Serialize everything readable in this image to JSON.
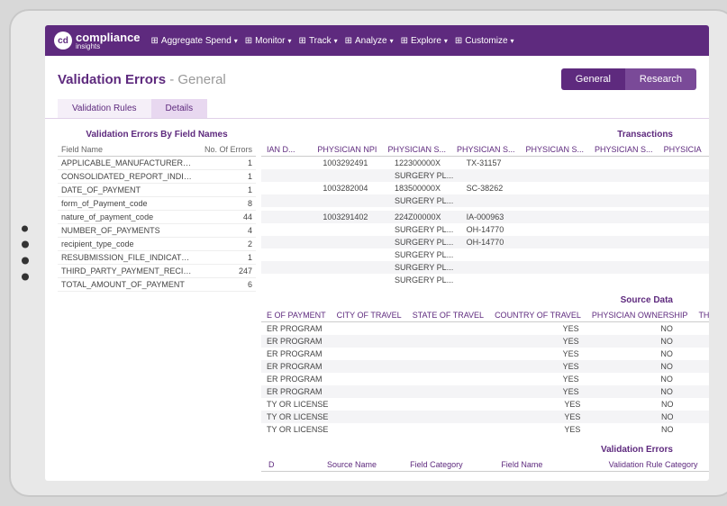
{
  "brand": {
    "name": "compliance",
    "sub": "insights",
    "badge": "cd"
  },
  "nav": [
    {
      "label": "Aggregate Spend"
    },
    {
      "label": "Monitor"
    },
    {
      "label": "Track"
    },
    {
      "label": "Analyze"
    },
    {
      "label": "Explore"
    },
    {
      "label": "Customize"
    }
  ],
  "page": {
    "title": "Validation Errors",
    "subtitle": "- General"
  },
  "segments": {
    "a": "General",
    "b": "Research"
  },
  "tabs": {
    "rules": "Validation Rules",
    "details": "Details"
  },
  "field_panel": {
    "title": "Validation Errors By Field Names",
    "col1": "Field Name",
    "col2": "No. Of Errors",
    "rows": [
      {
        "n": "APPLICABLE_MANUFACTURER_OR_A...",
        "c": 1
      },
      {
        "n": "CONSOLIDATED_REPORT_INDICATO...",
        "c": 1
      },
      {
        "n": "DATE_OF_PAYMENT",
        "c": 1
      },
      {
        "n": "form_of_Payment_code",
        "c": 8
      },
      {
        "n": "nature_of_payment_code",
        "c": 44
      },
      {
        "n": "NUMBER_OF_PAYMENTS",
        "c": 4
      },
      {
        "n": "recipient_type_code",
        "c": 2
      },
      {
        "n": "RESUBMISSION_FILE_INDICATOR_Code",
        "c": 1
      },
      {
        "n": "THIRD_PARTY_PAYMENT_RECIPIENT_I...",
        "c": 247
      },
      {
        "n": "TOTAL_AMOUNT_OF_PAYMENT",
        "c": 6
      }
    ]
  },
  "transactions": {
    "title": "Transactions",
    "cols": [
      "IAN D...",
      "PHYSICIAN NPI",
      "PHYSICIAN S...",
      "PHYSICIAN S...",
      "PHYSICIAN S...",
      "PHYSICIAN S...",
      "PHYSICIA"
    ],
    "rows": [
      {
        "npi": "1003292491",
        "s1": "122300000X",
        "s2": "TX-31157"
      },
      {
        "npi": "",
        "s1": "SURGERY PL...",
        "s2": ""
      },
      {
        "npi": "1003282004",
        "s1": "183500000X",
        "s2": "SC-38262"
      },
      {
        "npi": "",
        "s1": "SURGERY PL...",
        "s2": ""
      },
      {
        "npi": "",
        "s1": "",
        "s2": ""
      },
      {
        "npi": "1003291402",
        "s1": "224Z00000X",
        "s2": "IA-000963"
      },
      {
        "npi": "",
        "s1": "SURGERY PL...",
        "s2": "OH-14770"
      },
      {
        "npi": "",
        "s1": "SURGERY PL...",
        "s2": "OH-14770"
      },
      {
        "npi": "",
        "s1": "SURGERY PL...",
        "s2": ""
      },
      {
        "npi": "",
        "s1": "SURGERY PL...",
        "s2": ""
      },
      {
        "npi": "",
        "s1": "SURGERY PL...",
        "s2": ""
      }
    ]
  },
  "source": {
    "title": "Source Data",
    "cols": [
      "E OF PAYMENT",
      "CITY OF TRAVEL",
      "STATE OF TRAVEL",
      "COUNTRY OF TRAVEL",
      "PHYSICIAN OWNERSHIP",
      "THIRD P"
    ],
    "rows": [
      {
        "a": "ER PROGRAM",
        "o": "YES",
        "t": "NO"
      },
      {
        "a": "ER PROGRAM",
        "o": "YES",
        "t": "NO"
      },
      {
        "a": "ER PROGRAM",
        "o": "YES",
        "t": "NO"
      },
      {
        "a": "ER PROGRAM",
        "o": "YES",
        "t": "NO"
      },
      {
        "a": "ER PROGRAM",
        "o": "YES",
        "t": "NO"
      },
      {
        "a": "ER PROGRAM",
        "o": "YES",
        "t": "NO"
      },
      {
        "a": "TY OR LICENSE",
        "o": "YES",
        "t": "NO"
      },
      {
        "a": "TY OR LICENSE",
        "o": "YES",
        "t": "NO"
      },
      {
        "a": "TY OR LICENSE",
        "o": "YES",
        "t": "NO"
      }
    ]
  },
  "val": {
    "title": "Validation Errors",
    "cols": [
      "D",
      "Source Name",
      "Field Category",
      "Field Name",
      "Validation Rule Category"
    ]
  }
}
